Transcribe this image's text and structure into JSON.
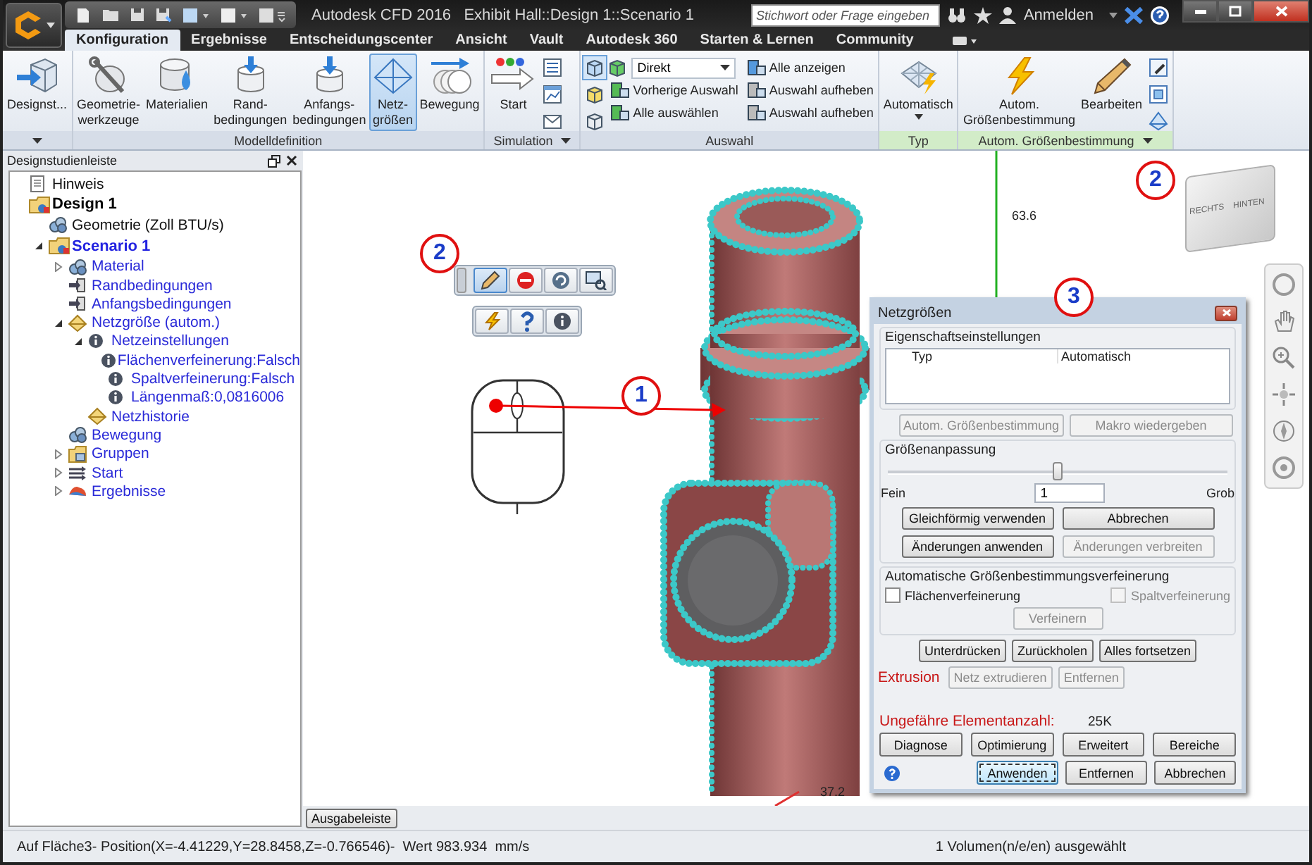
{
  "window": {
    "title": "Autodesk CFD 2016   Exhibit Hall::Design 1::Scenario 1"
  },
  "search": {
    "placeholder": "Stichwort oder Frage eingeben"
  },
  "account": {
    "label": "Anmelden"
  },
  "tabs": [
    {
      "label": "Konfiguration",
      "selected": true
    },
    {
      "label": "Ergebnisse",
      "selected": false
    },
    {
      "label": "Entscheidungscenter",
      "selected": false
    },
    {
      "label": "Ansicht",
      "selected": false
    },
    {
      "label": "Vault",
      "selected": false
    },
    {
      "label": "Autodesk 360",
      "selected": false
    },
    {
      "label": "Starten & Lernen",
      "selected": false
    },
    {
      "label": "Community",
      "selected": false
    }
  ],
  "ribbon": [
    {
      "contextual": false,
      "menu": true,
      "items": [
        {
          "kind": "large",
          "label": "Designst...",
          "selected": false
        }
      ]
    },
    {
      "label": "Modelldefinition",
      "contextual": false,
      "menu": false,
      "items": [
        {
          "kind": "large",
          "label": "Geometrie-\nwerkzeuge",
          "selected": false
        },
        {
          "kind": "large",
          "label": "Materialien",
          "selected": false
        },
        {
          "kind": "large",
          "label": "Rand-\nbedingungen",
          "selected": false
        },
        {
          "kind": "large",
          "label": "Anfangs-\nbedingungen",
          "selected": false
        },
        {
          "kind": "large",
          "label": "Netz-\ngrößen",
          "selected": true
        },
        {
          "kind": "large",
          "label": "Bewegung",
          "selected": false
        }
      ]
    },
    {
      "label": "Simulation",
      "contextual": false,
      "menu": true,
      "items": [
        {
          "kind": "large",
          "label": "Start",
          "selected": false
        }
      ]
    },
    {
      "label": "Auswahl",
      "contextual": false,
      "menu": false,
      "items": [
        {
          "kind": "dropdown",
          "label": "Direkt"
        },
        {
          "kind": "small",
          "label": "Vorherige Auswahl"
        },
        {
          "kind": "small",
          "label": "Alle auswählen"
        },
        {
          "kind": "small",
          "label": "Alle anzeigen"
        },
        {
          "kind": "small",
          "label": "Auswahl aufheben"
        },
        {
          "kind": "small",
          "label": "Auswahl aufheben"
        }
      ]
    },
    {
      "label": "Typ",
      "contextual": true,
      "menu": false,
      "items": [
        {
          "kind": "large",
          "label": "Automatisch",
          "selected": false,
          "menu": true
        }
      ]
    },
    {
      "label": "Autom. Größenbestimmung",
      "contextual": true,
      "menu": true,
      "items": [
        {
          "kind": "large",
          "label": "Autom.\nGrößenbestimmung",
          "selected": false
        },
        {
          "kind": "large",
          "label": "Bearbeiten",
          "selected": false
        }
      ]
    }
  ],
  "tree": {
    "title": "Designstudienleiste",
    "items": [
      {
        "label": "Hinweis",
        "kind": "plain"
      },
      {
        "label": "Design 1",
        "kind": "design",
        "children": [
          {
            "label": "Geometrie (Zoll BTU/s)",
            "kind": "plain"
          },
          {
            "label": "Scenario 1",
            "kind": "scenario",
            "expanded": true,
            "children": [
              {
                "label": "Material",
                "kind": "link",
                "expanded": false
              },
              {
                "label": "Randbedingungen",
                "kind": "link"
              },
              {
                "label": "Anfangsbedingungen",
                "kind": "link"
              },
              {
                "label": "Netzgröße (autom.)",
                "kind": "link",
                "expanded": true,
                "children": [
                  {
                    "label": "Netzeinstellungen",
                    "kind": "link",
                    "expanded": true,
                    "children": [
                      {
                        "label": "Flächenverfeinerung:Falsch",
                        "kind": "link"
                      },
                      {
                        "label": "Spaltverfeinerung:Falsch",
                        "kind": "link"
                      },
                      {
                        "label": "Längenmaß:0,0816006",
                        "kind": "link"
                      }
                    ]
                  },
                  {
                    "label": "Netzhistorie",
                    "kind": "link"
                  }
                ]
              },
              {
                "label": "Bewegung",
                "kind": "link"
              },
              {
                "label": "Gruppen",
                "kind": "link",
                "expanded": false
              },
              {
                "label": "Start",
                "kind": "link",
                "expanded": false
              },
              {
                "label": "Ergebnisse",
                "kind": "link",
                "expanded": false
              }
            ]
          }
        ]
      }
    ]
  },
  "viewport": {
    "mini_toolbar": [
      {
        "selected": true
      },
      {
        "selected": false
      },
      {
        "selected": false
      },
      {
        "selected": false
      },
      {
        "selected": false
      },
      {
        "selected": false
      },
      {
        "selected": false
      }
    ],
    "axis_labels": [
      "63.6",
      "37.2"
    ],
    "viewcube": [
      "RECHTS",
      "HINTEN"
    ],
    "callouts": [
      "1",
      "2",
      "2",
      "3"
    ],
    "output_button": "Ausgabeleiste"
  },
  "dialog": {
    "title": "Netzgrößen",
    "properties": {
      "title": "Eigenschaftseinstellungen",
      "rows": [
        {
          "name": "Typ",
          "value": "Automatisch"
        }
      ]
    },
    "property_buttons": [
      {
        "label": "Autom. Größenbestimmung",
        "disabled": true
      },
      {
        "label": "Makro wiedergeben",
        "disabled": true
      }
    ],
    "sizing": {
      "title": "Größenanpassung",
      "level": 0.5,
      "min_label": "Fein",
      "value": "1",
      "max_label": "Grob",
      "buttons": [
        {
          "label": "Gleichförmig verwenden",
          "disabled": false
        },
        {
          "label": "Abbrechen",
          "disabled": false
        },
        {
          "label": "Änderungen anwenden",
          "disabled": false
        },
        {
          "label": "Änderungen verbreiten",
          "disabled": true
        }
      ]
    },
    "refinement": {
      "title": "Automatische Größenbestimmungsverfeinerung",
      "options": [
        {
          "label": "Flächenverfeinerung",
          "checked": false,
          "disabled": false
        },
        {
          "label": "Spaltverfeinerung",
          "checked": false,
          "disabled": true
        }
      ],
      "button": {
        "label": "Verfeinern",
        "disabled": true
      }
    },
    "actions": [
      {
        "label": "Unterdrücken",
        "disabled": false
      },
      {
        "label": "Zurückholen",
        "disabled": false
      },
      {
        "label": "Alles fortsetzen",
        "disabled": false
      }
    ],
    "extrusion": {
      "label": "Extrusion",
      "buttons": [
        {
          "label": "Netz extrudieren",
          "disabled": true
        },
        {
          "label": "Entfernen",
          "disabled": true
        }
      ]
    },
    "count": {
      "label": "Ungefähre Elementanzahl:",
      "value": "25K"
    },
    "tools": [
      {
        "label": "Diagnose",
        "disabled": false
      },
      {
        "label": "Optimierung",
        "disabled": false
      },
      {
        "label": "Erweitert",
        "disabled": false
      },
      {
        "label": "Bereiche",
        "disabled": false
      }
    ],
    "footer": [
      {
        "label": "Anwenden",
        "focused": true
      },
      {
        "label": "Entfernen",
        "focused": false
      },
      {
        "label": "Abbrechen",
        "focused": false
      }
    ]
  },
  "status_bar": {
    "left": "Auf Fläche3- Position(X=-4.41229,Y=28.8458,Z=-0.766546)-  Wert 983.934  mm/s",
    "right": "1 Volumen(n/e/en) ausgewählt"
  }
}
